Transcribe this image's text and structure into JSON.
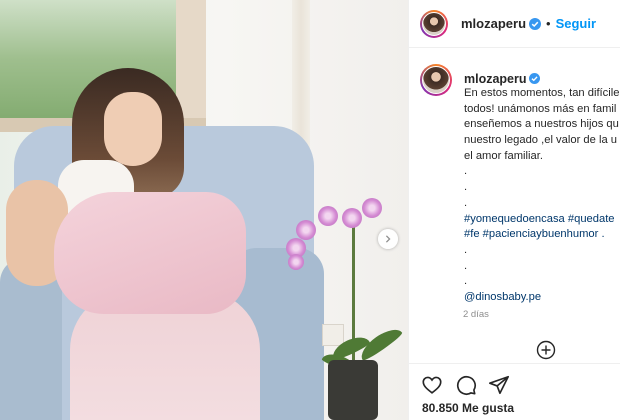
{
  "post": {
    "username": "mlozaperu",
    "follow_label": "Seguir",
    "separator": "•",
    "caption_lines": [
      "En estos momentos, tan difícile",
      "todos! unámonos más en famil",
      "enseñemos a nuestros hijos qu",
      "nuestro legado ,el valor de la u",
      "el amor familiar.",
      ".",
      ".",
      ".",
      "#yomequedoencasa #quedate",
      "#fe #pacienciaybuenhumor .",
      ".",
      ".",
      ".",
      "@dinosbaby.pe"
    ],
    "time_ago": "2 días",
    "likes": "80.850 Me gusta"
  },
  "icons": {
    "verified": "verified-badge-icon",
    "next": "chevron-right-icon",
    "add_comment": "plus-circle-icon",
    "like": "heart-icon",
    "comment": "comment-icon",
    "share": "send-icon"
  },
  "colors": {
    "accent": "#0095f6",
    "hashtag": "#00376b",
    "muted": "#8e8e8e",
    "verified": "#3897f0"
  }
}
